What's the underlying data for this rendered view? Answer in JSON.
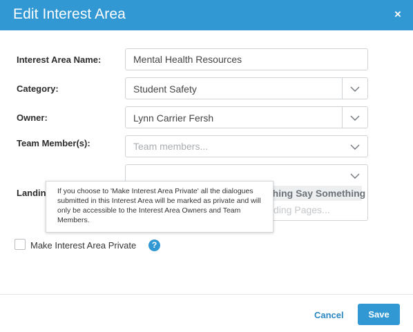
{
  "dialog": {
    "title": "Edit Interest Area",
    "close_glyph": "×",
    "close_icon": "close-icon"
  },
  "form": {
    "name": {
      "label": "Interest Area Name:",
      "value": "Mental Health Resources"
    },
    "category": {
      "label": "Category:",
      "value": "Student Safety"
    },
    "owner": {
      "label": "Owner:",
      "value": "Lynn Carrier Fersh"
    },
    "team": {
      "label": "Team Member(s):",
      "placeholder": "Team members..."
    },
    "landing": {
      "label_visible": "Landin",
      "selected_tag_visible": "thing Say Something",
      "placeholder_visible": "ding Pages..."
    }
  },
  "tooltip": {
    "text": "If you choose to 'Make Interest Area Private' all the dialogues submitted in this Interest Area will be marked as private and will only be accessible to the Interest Area Owners and Team Members."
  },
  "private": {
    "label": "Make Interest Area Private",
    "checked": false,
    "help_glyph": "?",
    "help_icon": "question-circle-icon"
  },
  "footer": {
    "cancel_label": "Cancel",
    "save_label": "Save"
  },
  "colors": {
    "header": "#3198d3",
    "primary_button": "#3198d3",
    "link": "#2a87c2"
  }
}
